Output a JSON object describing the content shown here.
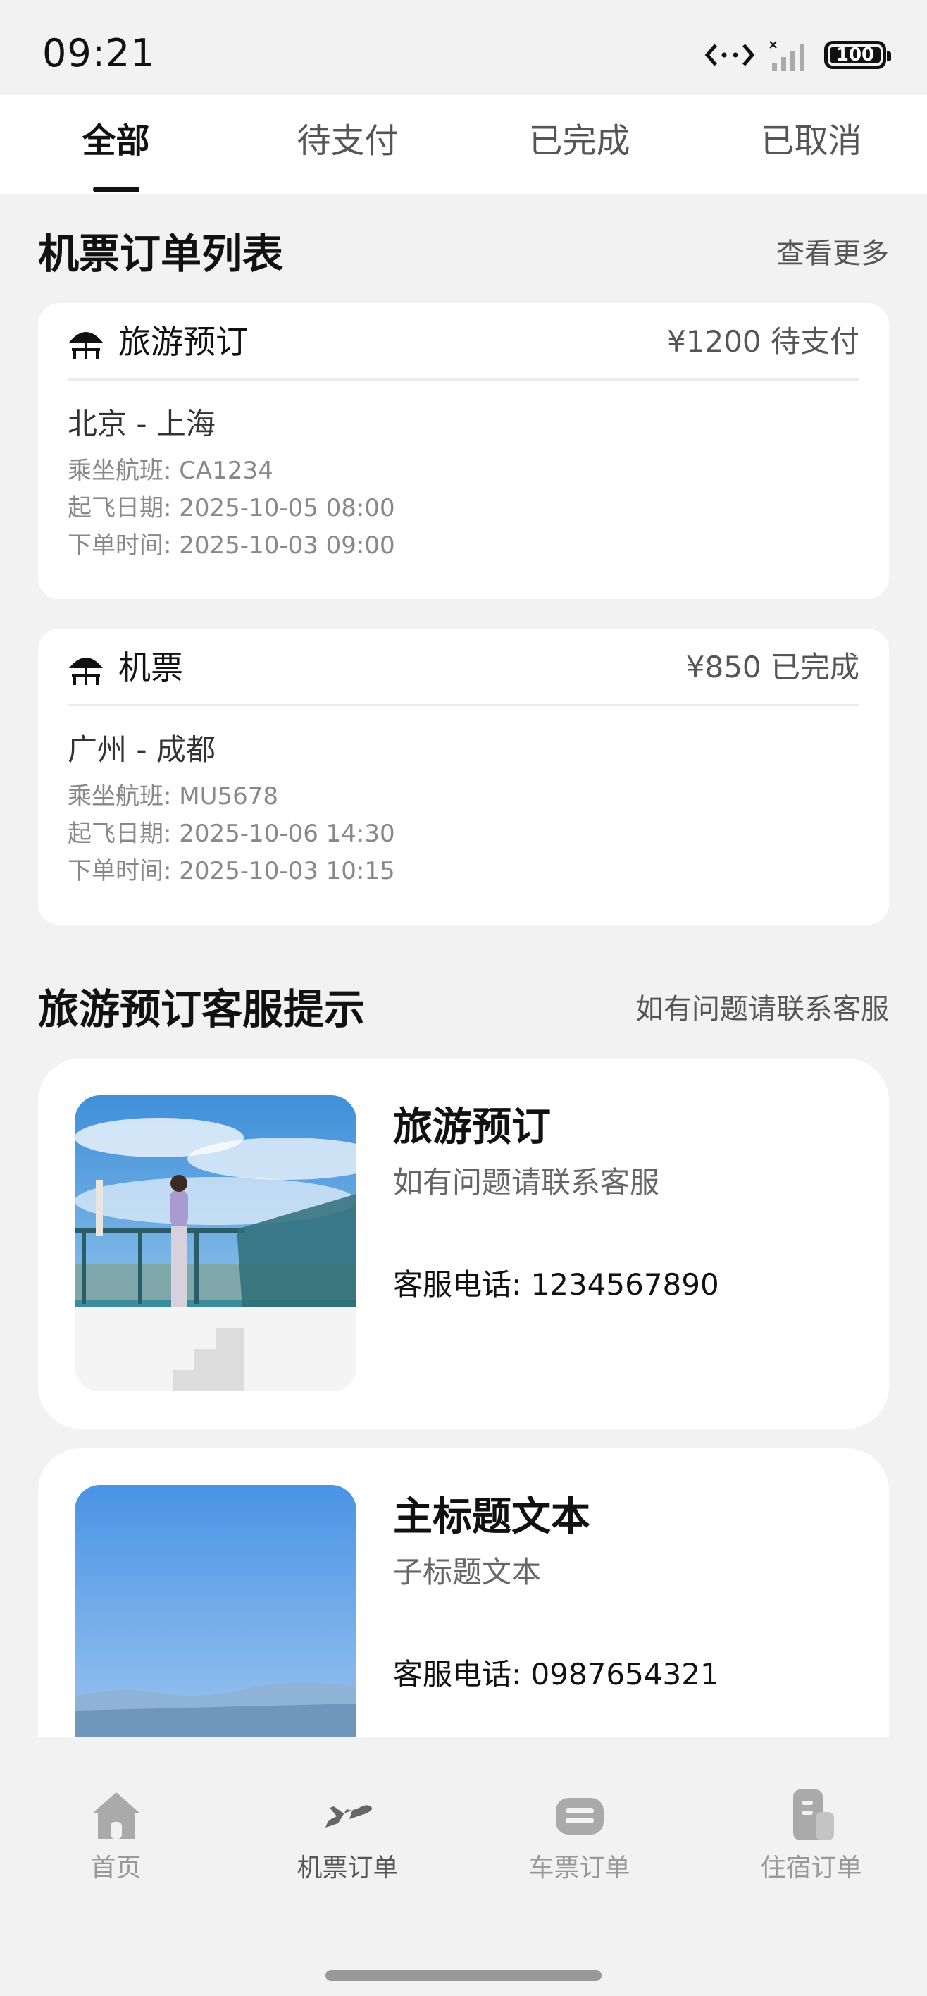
{
  "status_bar": {
    "time": "09:21",
    "battery": "100"
  },
  "tabs": [
    {
      "label": "全部",
      "active": true
    },
    {
      "label": "待支付",
      "active": false
    },
    {
      "label": "已完成",
      "active": false
    },
    {
      "label": "已取消",
      "active": false
    }
  ],
  "orders_section": {
    "title": "机票订单列表",
    "link": "查看更多"
  },
  "orders": [
    {
      "type": "旅游预订",
      "price_status": "¥1200 待支付",
      "route": "北京 - 上海",
      "flight": "乘坐航班:  CA1234",
      "departure": "起飞日期:  2025-10-05 08:00",
      "ordered": "下单时间:  2025-10-03 09:00"
    },
    {
      "type": "机票",
      "price_status": "¥850 已完成",
      "route": "广州 - 成都",
      "flight": "乘坐航班:  MU5678",
      "departure": "起飞日期:  2025-10-06 14:30",
      "ordered": "下单时间:  2025-10-03 10:15"
    }
  ],
  "service_section": {
    "title": "旅游预订客服提示",
    "link": "如有问题请联系客服"
  },
  "service_cards": [
    {
      "title": "旅游预订",
      "subtitle": "如有问题请联系客服",
      "phone": "客服电话:  1234567890"
    },
    {
      "title": "主标题文本",
      "subtitle": "子标题文本",
      "phone": "客服电话:  0987654321"
    }
  ],
  "bottom_nav": [
    {
      "label": "首页",
      "icon": "home-icon",
      "active": false
    },
    {
      "label": "机票订单",
      "icon": "plane-icon",
      "active": true
    },
    {
      "label": "车票订单",
      "icon": "train-ticket-icon",
      "active": false
    },
    {
      "label": "住宿订单",
      "icon": "lodging-icon",
      "active": false
    }
  ],
  "colors": {
    "background": "#f2f2f2",
    "card": "#ffffff",
    "text": "#111111",
    "muted": "#888888"
  }
}
